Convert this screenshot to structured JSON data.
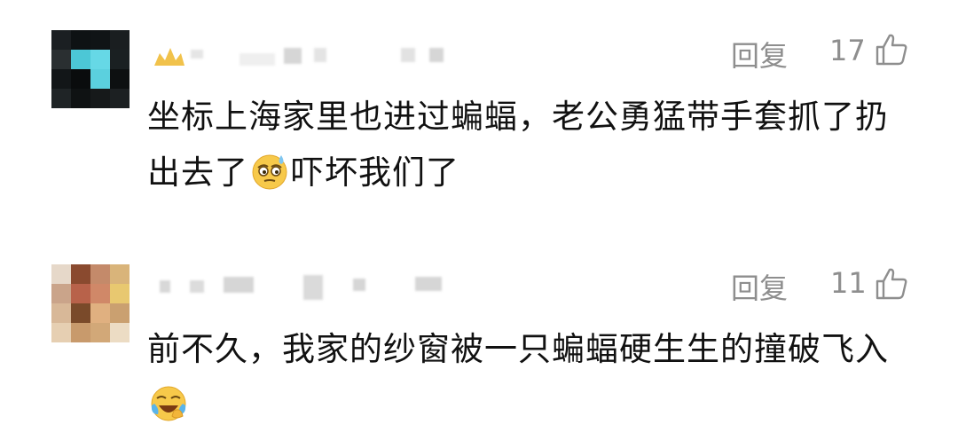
{
  "comments": [
    {
      "reply_label": "回复",
      "like_count": "17",
      "text_before_emoji": "坐标上海家里也进过蝙蝠，老公勇猛带手套抓了扔出去了",
      "text_after_emoji": "吓坏我们了",
      "emoji": "cold-sweat-emoji"
    },
    {
      "reply_label": "回复",
      "like_count": "11",
      "text_before_emoji": "前不久，我家的纱窗被一只蝙蝠硬生生的撞破飞入",
      "text_after_emoji": "",
      "emoji": "laughing-tears-emoji"
    }
  ],
  "colors": {
    "meta_gray": "#8e8e8e",
    "text": "#111111",
    "blur_gray": "#d6d6d6"
  }
}
